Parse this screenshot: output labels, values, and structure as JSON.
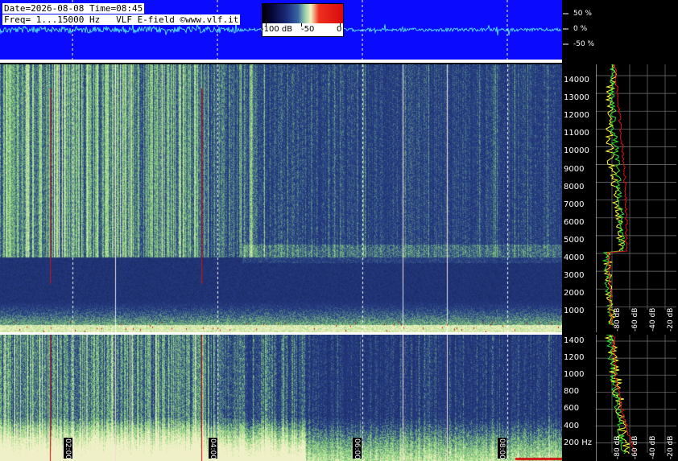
{
  "header": {
    "line1": "Date=2026-08-08 Time=08:45",
    "line2": "Freq= 1...15000 Hz   VLF E-field ©www.vlf.it"
  },
  "waveform": {
    "amplitude_labels": [
      "50 %",
      "0 %",
      "-50 %"
    ]
  },
  "colorbar": {
    "ticks": [
      "-100 dB",
      "-50",
      "0"
    ]
  },
  "spectrogram": {
    "freq_ticks": [
      "14000",
      "13000",
      "12000",
      "11000",
      "10000",
      "9000",
      "8000",
      "7000",
      "6000",
      "5000",
      "4000",
      "3000",
      "2000",
      "1000"
    ],
    "zoom_freq_ticks": [
      "1400",
      "1200",
      "1000",
      "800",
      "600",
      "400",
      "200 Hz"
    ],
    "time_labels": [
      "02:00",
      "04:00",
      "06:00",
      "08:00"
    ]
  },
  "spectrum_panel": {
    "db_ticks": [
      "-80 dB",
      "-60 dB",
      "-40 dB",
      "-20 dB"
    ],
    "zoom_db_ticks": [
      "-80 dB",
      "-60 dB",
      "-40 dB",
      "-20 dB"
    ]
  },
  "colors": {
    "waveform_bg": "#0a0aff",
    "trace": "#4ed8ff",
    "spectrogram_base": "#23346f",
    "hot": "#d01010"
  }
}
